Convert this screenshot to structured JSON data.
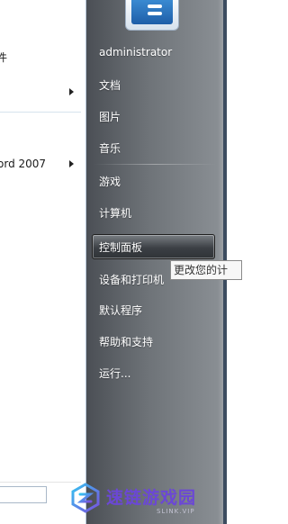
{
  "left_menu": {
    "items": [
      {
        "label": "件",
        "has_submenu": false
      },
      {
        "label": "",
        "has_submenu": true
      },
      {
        "label": "ord 2007",
        "has_submenu": true
      }
    ]
  },
  "right_menu": {
    "items": [
      {
        "label": "administrator"
      },
      {
        "label": "文档"
      },
      {
        "label": "图片"
      },
      {
        "label": "音乐"
      },
      {
        "label": "游戏"
      },
      {
        "label": "计算机"
      },
      {
        "label": "控制面板",
        "highlighted": true
      },
      {
        "label": "设备和打印机"
      },
      {
        "label": "默认程序"
      },
      {
        "label": "帮助和支持"
      },
      {
        "label": "运行..."
      }
    ]
  },
  "tooltip": {
    "text": "更改您的计"
  },
  "watermark": {
    "title": "速链游戏园",
    "subtitle": "SLINK.VIP"
  },
  "colors": {
    "right_panel": "#6e7378",
    "watermark": "#6b47d6"
  }
}
